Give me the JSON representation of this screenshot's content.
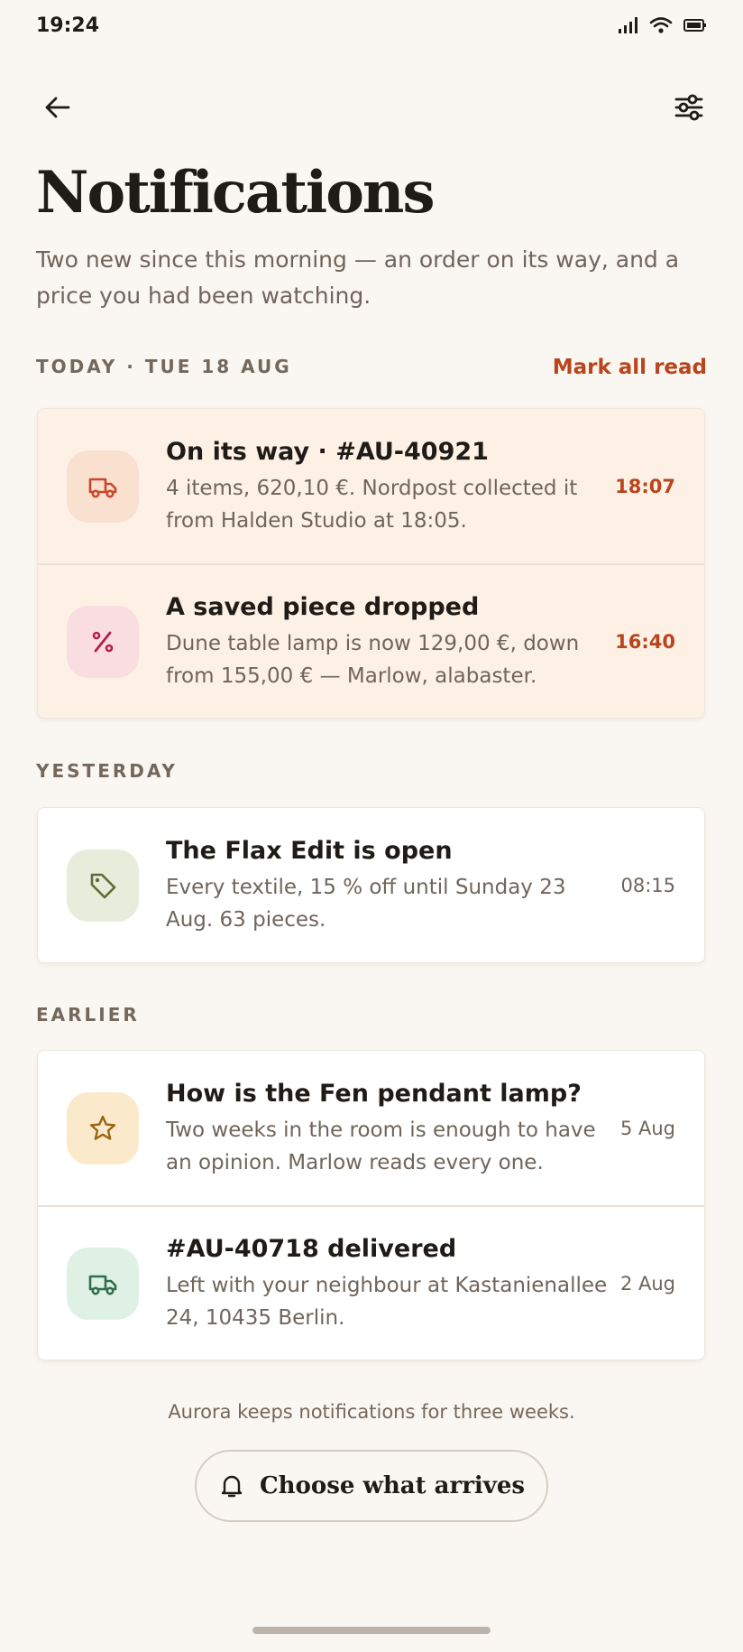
{
  "status_bar": {
    "time": "19:24"
  },
  "header": {
    "title": "Notifications",
    "subtitle": "Two new since this morning — an order on its way, and a price you had been watching."
  },
  "sections": {
    "today": {
      "heading": "TODAY · TUE 18 AUG",
      "action": "Mark all read",
      "items": [
        {
          "title": "On its way · #AU-40921",
          "body": "4 items, 620,10 €. Nordpost collected it from Halden Studio at 18:05.",
          "time": "18:07",
          "icon": "truck-icon"
        },
        {
          "title": "A saved piece dropped",
          "body": "Dune table lamp is now 129,00 €, down from 155,00 € — Marlow, alabaster.",
          "time": "16:40",
          "icon": "percent-icon"
        }
      ]
    },
    "yesterday": {
      "heading": "YESTERDAY",
      "items": [
        {
          "title": "The Flax Edit is open",
          "body": "Every textile, 15 % off until Sunday 23 Aug. 63 pieces.",
          "time": "08:15",
          "icon": "tag-icon"
        }
      ]
    },
    "earlier": {
      "heading": "EARLIER",
      "items": [
        {
          "title": "How is the Fen pendant lamp?",
          "body": "Two weeks in the room is enough to have an opinion. Marlow reads every one.",
          "time": "5 Aug",
          "icon": "star-icon"
        },
        {
          "title": "#AU-40718 delivered",
          "body": "Left with your neighbour at Kastanienallee 24, 10435 Berlin.",
          "time": "2 Aug",
          "icon": "truck-icon"
        }
      ]
    }
  },
  "footer": {
    "note": "Aurora keeps notifications for three weeks.",
    "button_label": "Choose what arrives"
  },
  "colors": {
    "background": "#faf6f1",
    "accent": "#b8451c",
    "unread_card": "#fdf1e6"
  }
}
